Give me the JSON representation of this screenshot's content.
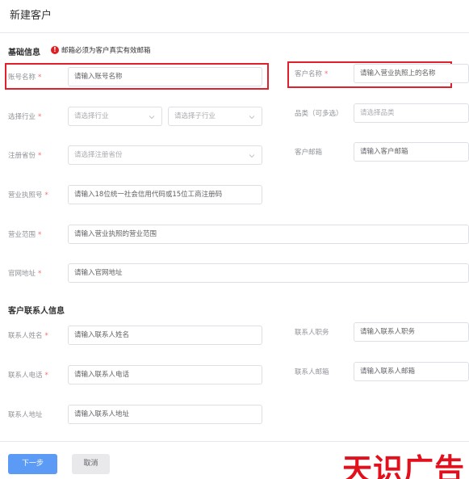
{
  "page_title": "新建客户",
  "basic_section": {
    "title": "基础信息",
    "note": "邮箱必须为客户真实有效邮箱"
  },
  "contact_section": {
    "title": "客户联系人信息"
  },
  "fields": {
    "account_name": {
      "label": "账号名称",
      "placeholder": "请输入账号名称"
    },
    "customer_name": {
      "label": "客户名称",
      "placeholder": "请输入营业执照上的名称"
    },
    "industry": {
      "label": "选择行业",
      "placeholder": "请选择行业",
      "sub_placeholder": "请选择子行业"
    },
    "category": {
      "label": "品类（可多选）",
      "placeholder": "请选择品类"
    },
    "province": {
      "label": "注册省份",
      "placeholder": "请选择注册省份"
    },
    "customer_email": {
      "label": "客户邮箱",
      "placeholder": "请输入客户邮箱"
    },
    "license_no": {
      "label": "营业执照号",
      "placeholder": "请输入18位统一社会信用代码或15位工商注册码"
    },
    "business_scope": {
      "label": "营业范围",
      "placeholder": "请输入营业执照的营业范围"
    },
    "website": {
      "label": "官网地址",
      "placeholder": "请输入官网地址"
    },
    "contact_name": {
      "label": "联系人姓名",
      "placeholder": "请输入联系人姓名"
    },
    "contact_title": {
      "label": "联系人职务",
      "placeholder": "请输入联系人职务"
    },
    "contact_phone": {
      "label": "联系人电话",
      "placeholder": "请输入联系人电话"
    },
    "contact_email": {
      "label": "联系人邮箱",
      "placeholder": "请输入联系人邮箱"
    },
    "contact_address": {
      "label": "联系人地址",
      "placeholder": "请输入联系人地址"
    }
  },
  "required_mark": "*",
  "note_icon": "!",
  "buttons": {
    "next": "下一步",
    "cancel": "取消"
  },
  "watermark": "天识广告",
  "colors": {
    "primary": "#5b9bf5",
    "required": "#f56c6c",
    "highlight": "#e0202a",
    "watermark": "#e1101c"
  }
}
